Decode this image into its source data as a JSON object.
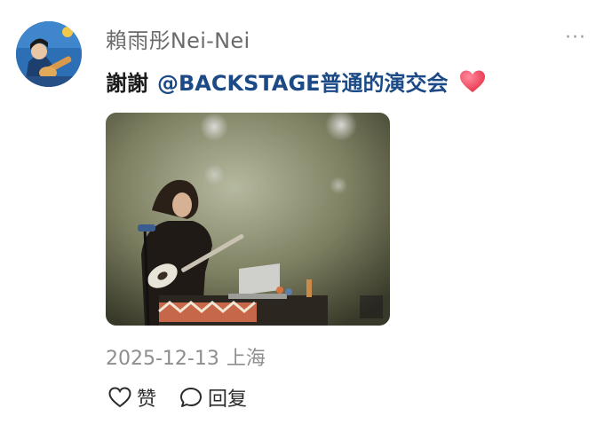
{
  "author": {
    "name": "賴雨彤Nei-Nei"
  },
  "post": {
    "text": "謝謝",
    "mention": "@BACKSTAGE普通的演交会",
    "emoji": "heart-icon",
    "date": "2025-12-13",
    "location": "上海"
  },
  "actions": {
    "like_label": "赞",
    "reply_label": "回复",
    "more_label": "···"
  },
  "colors": {
    "mention": "#1c4a86",
    "heart": "#f0465f",
    "meta": "#8e8e8e"
  }
}
